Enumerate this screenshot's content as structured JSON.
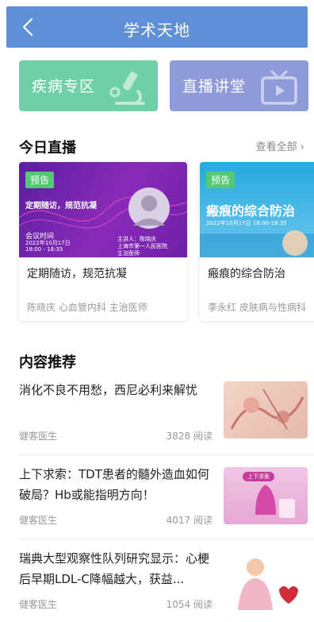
{
  "header": {
    "title": "学术天地"
  },
  "categories": [
    {
      "label": "疾病专区"
    },
    {
      "label": "直播讲堂"
    }
  ],
  "today_live": {
    "section_title": "今日直播",
    "see_all": "查看全部 ›",
    "cards": [
      {
        "badge": "预告",
        "poster_headline": "定期随访，规范抗凝",
        "poster_time_label": "会议时间",
        "poster_date": "2022年10月17日",
        "poster_hours": "18:00 - 18:35",
        "poster_speaker": "主讲人：陈晓庆",
        "poster_org": "上海市第一人民医院",
        "poster_role": "主治医师",
        "title": "定期随访，规范抗凝",
        "meta": "陈晓庆  心血管内科  主治医师"
      },
      {
        "badge": "预告",
        "poster_headline": "瘢痕的综合防治",
        "poster_date": "2022年10月17日 18:00-18:35",
        "title": "瘢痕的综合防治",
        "meta": "李永红  皮肤病与性病科"
      }
    ]
  },
  "recommend": {
    "section_title": "内容推荐",
    "articles": [
      {
        "title": "消化不良不用愁，西尼必利来解忧",
        "author": "健客医生",
        "reads": "3828 阅读"
      },
      {
        "title": "上下求索：TDT患者的髓外造血如何破局？Hb或能指明方向！",
        "author": "健客医生",
        "reads": "4017 阅读",
        "thumb_caption": "上下求索"
      },
      {
        "title": "瑞典大型观察性队列研究显示：心梗后早期LDL-C降幅越大，获益...",
        "author": "健客医生",
        "reads": "1054 阅读"
      }
    ]
  },
  "colors": {
    "header": "#5f8fd6",
    "disease_card": "#6fd0a6",
    "live_card": "#8f9ad9",
    "badge": "#56c774"
  }
}
